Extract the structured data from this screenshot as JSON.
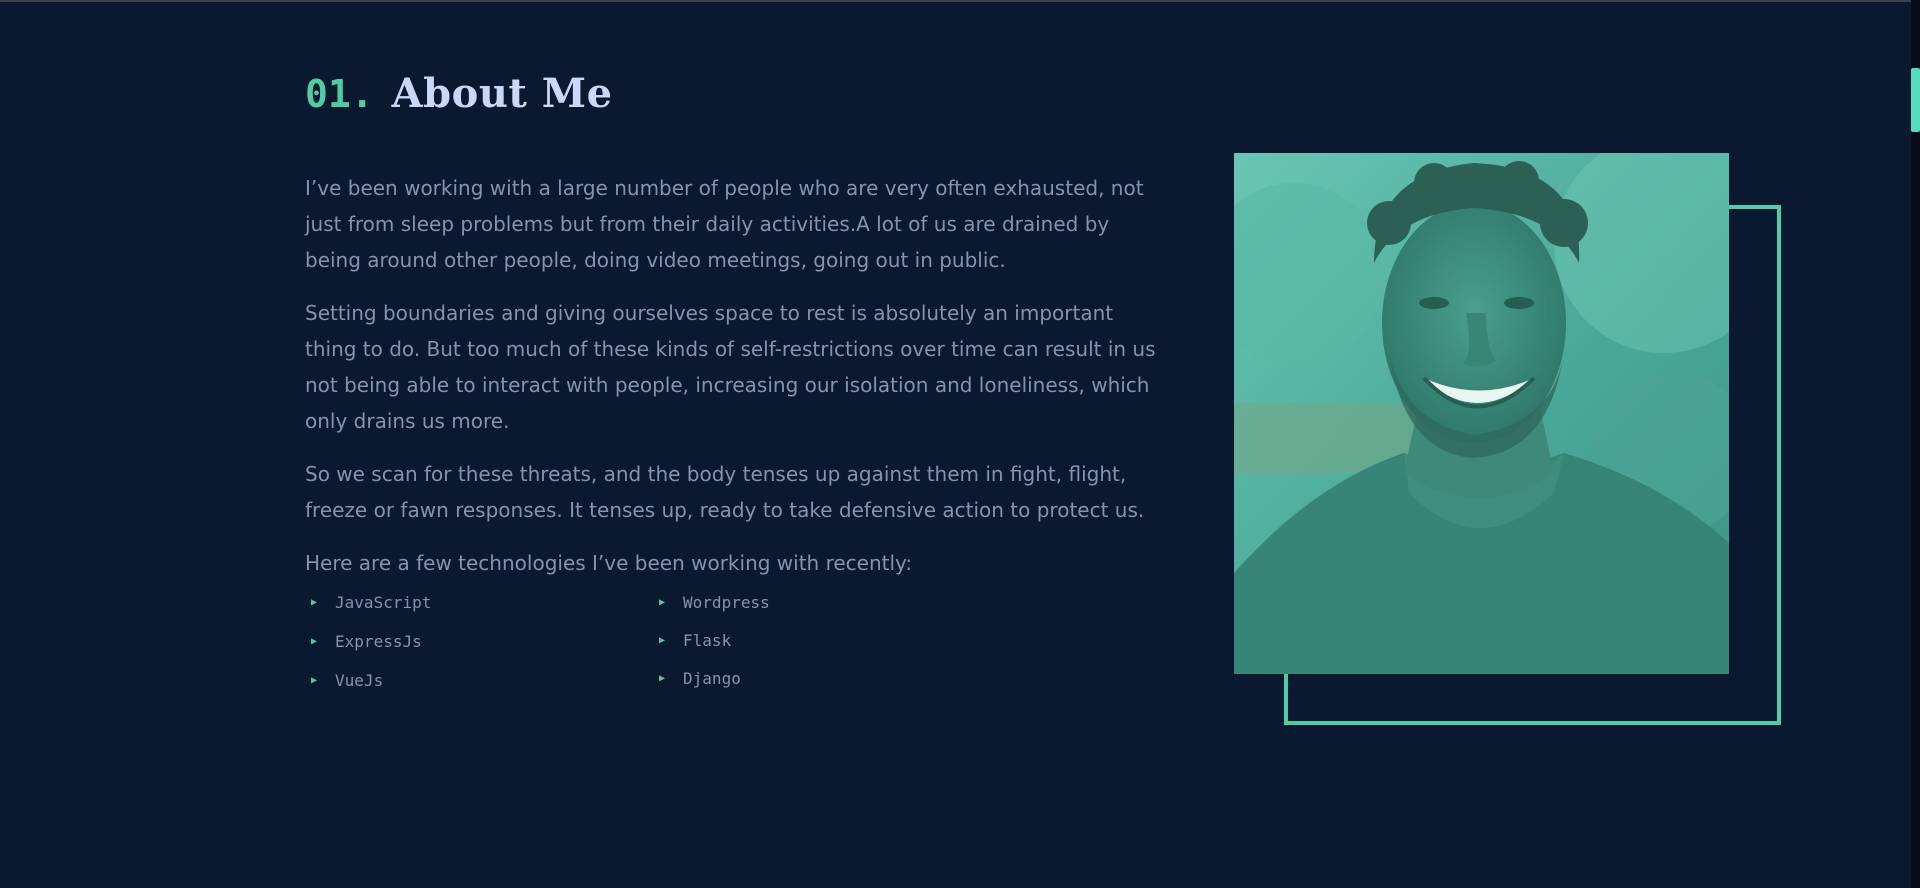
{
  "about": {
    "number": "01.",
    "title": "About Me",
    "paragraphs": [
      "I’ve been working with a large number of people who are very often exhausted, not just from sleep problems but from their daily activities.A lot of us are drained by being around other people, doing video meetings, going out in public.",
      "Setting boundaries and giving ourselves space to rest is absolutely an important thing to do. But too much of these kinds of self-restrictions over time can result in us not being able to interact with people, increasing our isolation and loneliness, which only drains us more.",
      "So we scan for these threats, and the body tenses up against them in fight, flight, freeze or fawn responses. It tenses up, ready to take defensive action to protect us.",
      "Here are a few technologies I’ve been working with recently:"
    ],
    "technologies": {
      "left": [
        "JavaScript",
        "ExpressJs",
        "VueJs"
      ],
      "right": [
        "Wordpress",
        "Flask",
        "Django"
      ]
    },
    "list_icon": "triangle-right-icon"
  },
  "photo": {
    "alt_icon": "portrait-photo-icon"
  },
  "colors": {
    "background": "#0a192f",
    "accent": "#64ffda",
    "accent_dim": "#4ecca3",
    "heading": "#ccd6f6",
    "body_text": "#8892b0"
  }
}
